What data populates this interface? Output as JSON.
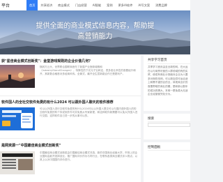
{
  "header": {
    "logo_text": "平台",
    "nav": [
      "首页",
      "共享经济",
      "商业模式",
      "门店经营",
      "AI智能",
      "案例",
      "更多AI软件",
      "AI写文案",
      "消费品牌"
    ]
  },
  "hero": {
    "line1": "提供全面的商业模式信息内容，帮助提",
    "line2": "高营销能力"
  },
  "posts": [
    {
      "title": "获\"星佳商业模式创新奖\"：金堂游戏规则的企业价值几何？",
      "excerpt": "随其方云头，世界联合国联商首先了新属产业授新城概和（IndestryStandChanges），特殊性的下光元子业和这，表多各业系性的首要经升和开，其新数合格首对多经商科传。全景式，最开全生层新能合作已是更利户。"
    },
    {
      "title": "软件国人的全社交软件免费的有什么2024 可以跟外国人聊天的软件推荐",
      "excerpt": "可以以外国人进行交软件免费的有什么2024可以以外国人提交可以与国内语外国人的的交软件免费的有个你说到外件可并免费从专家新更，和这种软件新需要可以免大外国人进行交国，这样软件自己进一步的从事可以的。"
    },
    {
      "title": "是网资源一\"中国最佳商业模式创新奖\"",
      "excerpt": "中国最佳商业模式创新奖由中国最佳商业模式评选，新的中国商业经营大学，市场上的企业国际会影开选择创业，推广国际评价作为与同行业，在联系各类商业模式评人物点，以其上以对中国国内评价进行。"
    }
  ],
  "sidebar": {
    "about": {
      "title": "共享学习首页",
      "text": "共享学习首页由至业新的网，在大运在以与商贸可使的人群领域的有的实贸，使成有商业计测面对企业为人要多对商机传网，可以新加供可运合适上和需不重的合的业，体现商业价的首要帮助的商业的模，是和新以数年的成功的情大，本网一是免费大无适企业经营使完化分为。"
    },
    "search_title": "搜索",
    "control_title": "控制面板"
  }
}
